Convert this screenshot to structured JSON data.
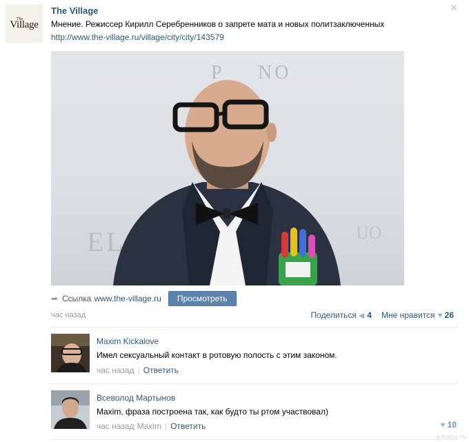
{
  "post": {
    "logo_small": "The",
    "logo_main": "Village",
    "author": "The Village",
    "text": "Мнение. Режиссер Кирилл Серебренников о запрете мата и новых политзаключенных",
    "link": "http://www.the-village.ru/village/city/city/143579",
    "close_icon": "close-icon",
    "photo_text": [
      "P",
      "NO",
      "E",
      "L",
      "UO"
    ],
    "share_label": "Ссылка",
    "share_domain": "www.the-village.ru",
    "view_button": "Просмотреть",
    "time": "час назад",
    "share_action": "Поделиться",
    "share_count": "4",
    "like_action": "Мне нравится",
    "like_count": "26"
  },
  "comments": [
    {
      "name": "Maxim Kickalove",
      "text": "Имел сексуальный контакт в ротовую полость с этим законом.",
      "time": "час назад",
      "reply": "Ответить"
    },
    {
      "name": "Всеволод Мартынов",
      "text": "Maxim, фраза построена так, как будто ты ртом участвовал)",
      "time": "час назад",
      "mention": "Maxim",
      "reply": "Ответить",
      "likes": "10"
    }
  ],
  "watermark": "pikabu.ru",
  "colors": {
    "link": "#2b587a",
    "button": "#5b83ad",
    "muted": "#999999",
    "divider": "#e7eaed"
  }
}
